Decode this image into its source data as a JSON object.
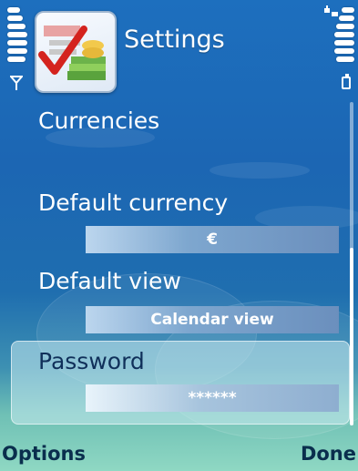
{
  "header": {
    "title": "Settings",
    "app_icon": "currency-settings-icon"
  },
  "status": {
    "signal_icon": "antenna-icon",
    "battery_icon": "battery-icon",
    "connection_icon": "connection-icon"
  },
  "list": {
    "section_title": "Currencies",
    "items": [
      {
        "label": "Default currency",
        "value": "€"
      },
      {
        "label": "Default view",
        "value": "Calendar view"
      },
      {
        "label": "Password",
        "value": "******",
        "selected": true
      }
    ]
  },
  "softkeys": {
    "left": "Options",
    "right": "Done"
  },
  "colors": {
    "background_top": "#1d6fbe",
    "background_bottom": "#8fd8c3",
    "softkey_text": "#0a2e4d",
    "selected_label": "#10305a"
  }
}
